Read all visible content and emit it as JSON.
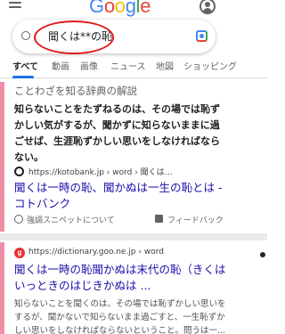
{
  "header": {
    "logo_letters": [
      "G",
      "o",
      "o",
      "g",
      "l",
      "e"
    ],
    "icons": {
      "menu": "menu-icon",
      "account": "account-icon"
    }
  },
  "search": {
    "query": "聞くは**の恥",
    "icons": {
      "search": "search-icon",
      "lens": "google-lens-icon"
    },
    "highlight_color": "#e01a1a"
  },
  "tabs": [
    {
      "label": "すべて",
      "active": true
    },
    {
      "label": "動画",
      "active": false
    },
    {
      "label": "画像",
      "active": false
    },
    {
      "label": "ニュース",
      "active": false
    },
    {
      "label": "地図",
      "active": false
    },
    {
      "label": "ショッピング",
      "active": false
    }
  ],
  "featured": {
    "heading": "ことわざを知る辞典の解説",
    "snippet": "知らないことをたずねるのは、その場では恥ずかしい気がするが、聞かずに知らないままに過ごせば、生涯恥ずかしい思いをしなければならない。",
    "source_url": "https://kotobank.jp › word › 聞くは…",
    "title": "聞くは一時の恥、聞かぬは一生の恥とは - コトバンク",
    "about_label": "強調スニペットについて",
    "feedback_label": "フィードバック"
  },
  "result2": {
    "source_url": "https://dictionary.goo.ne.jp › word",
    "title": "聞くは一時の恥聞かぬは末代の恥（きくはいっときのはじきかぬは ...",
    "description": "知らないことを聞くのは、その場では恥ずかしい思いをするが、聞かないで知らないまま過ごすと、一生恥ずかしい思いをしなければならないということ。問うは一..."
  },
  "colors": {
    "link": "#1a0dab",
    "accent": "#ef8fa6",
    "tab_indicator": "#1a73e8"
  }
}
